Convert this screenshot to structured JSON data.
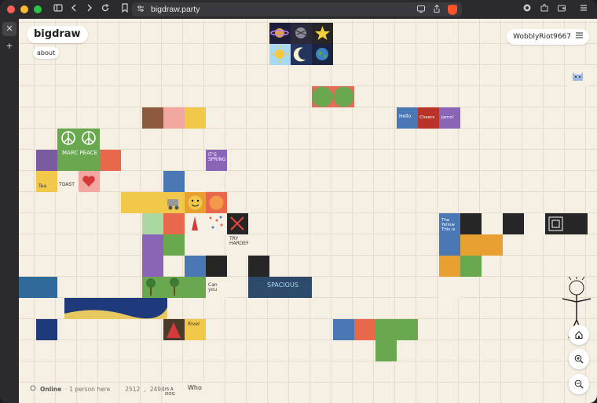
{
  "browser": {
    "url": "bigdraw.party"
  },
  "app": {
    "logo": "bigdraw",
    "about_label": "about",
    "username": "WobblyRiot9667",
    "status_online": "Online",
    "status_people": "· 1 person here",
    "coord_x": "2512",
    "coord_sep": ",",
    "coord_y": "2494"
  },
  "tile_texts": {
    "marc_peace": "MARC PEACE",
    "hello": "Hello",
    "cheers": "Cheers",
    "jamo": "Jamo!",
    "its_spring": "IT'S SPRING",
    "tea": "Tea",
    "toast": "TOAST",
    "try_harder": "TRY HARDER",
    "spacious": "SPACIOUS",
    "the_yellow_is_this": "The Yellow This is",
    "river": "River",
    "can_you": "Can you",
    "who": "Who",
    "is_a_dog": "IS A DOG"
  },
  "colors": {
    "accent_green": "#6aa84f",
    "brave_orange": "#fb542b"
  },
  "icons": [
    "sidebar-icon",
    "back-icon",
    "forward-icon",
    "reload-icon",
    "bookmark-icon",
    "site-settings-icon",
    "cast-icon",
    "share-icon",
    "brave-shield-icon",
    "brave-rewards-icon",
    "extensions-icon",
    "wallet-icon",
    "menu-icon",
    "close-icon",
    "plus-icon",
    "hamburger-icon",
    "home-icon",
    "zoom-in-icon",
    "zoom-out-icon",
    "online-icon"
  ]
}
